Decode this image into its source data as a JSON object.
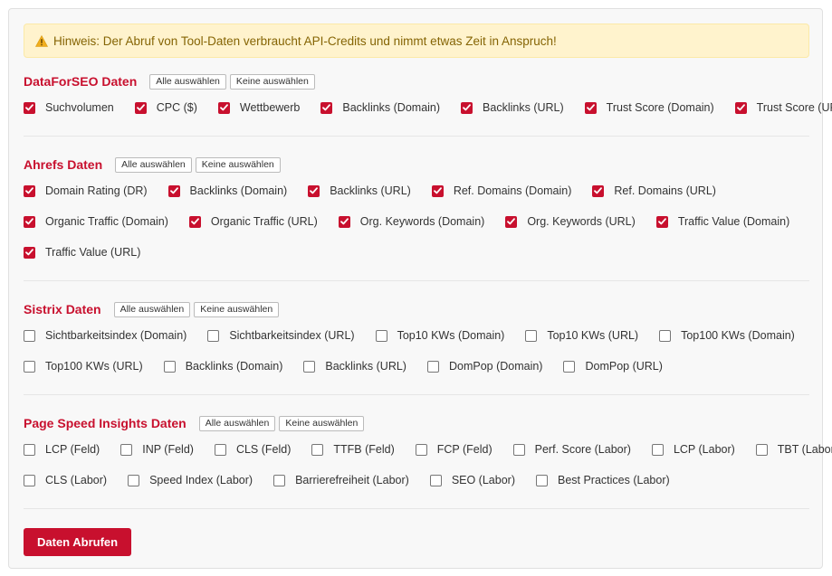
{
  "notice": {
    "text": "Hinweis: Der Abruf von Tool-Daten verbraucht API-Credits und nimmt etwas Zeit in Anspruch!",
    "icon": "warning-icon"
  },
  "colors": {
    "accent": "#c8102e",
    "notice_bg": "#fff3cd",
    "notice_text": "#856404"
  },
  "sections": [
    {
      "title": "DataForSEO Daten",
      "select_all": "Alle auswählen",
      "select_none": "Keine auswählen",
      "rows": [
        [
          {
            "label": "Suchvolumen",
            "checked": true
          },
          {
            "label": "CPC ($)",
            "checked": true
          },
          {
            "label": "Wettbewerb",
            "checked": true
          },
          {
            "label": "Backlinks (Domain)",
            "checked": true
          },
          {
            "label": "Backlinks (URL)",
            "checked": true
          },
          {
            "label": "Trust Score (Domain)",
            "checked": true
          },
          {
            "label": "Trust Score (URL)",
            "checked": true
          }
        ]
      ]
    },
    {
      "title": "Ahrefs Daten",
      "select_all": "Alle auswählen",
      "select_none": "Keine auswählen",
      "rows": [
        [
          {
            "label": "Domain Rating (DR)",
            "checked": true
          },
          {
            "label": "Backlinks (Domain)",
            "checked": true
          },
          {
            "label": "Backlinks (URL)",
            "checked": true
          },
          {
            "label": "Ref. Domains (Domain)",
            "checked": true
          },
          {
            "label": "Ref. Domains (URL)",
            "checked": true
          }
        ],
        [
          {
            "label": "Organic Traffic (Domain)",
            "checked": true
          },
          {
            "label": "Organic Traffic (URL)",
            "checked": true
          },
          {
            "label": "Org. Keywords (Domain)",
            "checked": true
          },
          {
            "label": "Org. Keywords (URL)",
            "checked": true
          },
          {
            "label": "Traffic Value (Domain)",
            "checked": true
          }
        ],
        [
          {
            "label": "Traffic Value (URL)",
            "checked": true
          }
        ]
      ]
    },
    {
      "title": "Sistrix Daten",
      "select_all": "Alle auswählen",
      "select_none": "Keine auswählen",
      "rows": [
        [
          {
            "label": "Sichtbarkeitsindex (Domain)",
            "checked": false
          },
          {
            "label": "Sichtbarkeitsindex (URL)",
            "checked": false
          },
          {
            "label": "Top10 KWs (Domain)",
            "checked": false
          },
          {
            "label": "Top10 KWs (URL)",
            "checked": false
          },
          {
            "label": "Top100 KWs (Domain)",
            "checked": false
          }
        ],
        [
          {
            "label": "Top100 KWs (URL)",
            "checked": false
          },
          {
            "label": "Backlinks (Domain)",
            "checked": false
          },
          {
            "label": "Backlinks (URL)",
            "checked": false
          },
          {
            "label": "DomPop (Domain)",
            "checked": false
          },
          {
            "label": "DomPop (URL)",
            "checked": false
          }
        ]
      ]
    },
    {
      "title": "Page Speed Insights Daten",
      "select_all": "Alle auswählen",
      "select_none": "Keine auswählen",
      "rows": [
        [
          {
            "label": "LCP (Feld)",
            "checked": false
          },
          {
            "label": "INP (Feld)",
            "checked": false
          },
          {
            "label": "CLS (Feld)",
            "checked": false
          },
          {
            "label": "TTFB (Feld)",
            "checked": false
          },
          {
            "label": "FCP (Feld)",
            "checked": false
          },
          {
            "label": "Perf. Score (Labor)",
            "checked": false
          },
          {
            "label": "LCP (Labor)",
            "checked": false
          },
          {
            "label": "TBT (Labor)",
            "checked": false
          }
        ],
        [
          {
            "label": "CLS (Labor)",
            "checked": false
          },
          {
            "label": "Speed Index (Labor)",
            "checked": false
          },
          {
            "label": "Barrierefreiheit (Labor)",
            "checked": false
          },
          {
            "label": "SEO (Labor)",
            "checked": false
          },
          {
            "label": "Best Practices (Labor)",
            "checked": false
          }
        ]
      ]
    }
  ],
  "submit_label": "Daten Abrufen"
}
